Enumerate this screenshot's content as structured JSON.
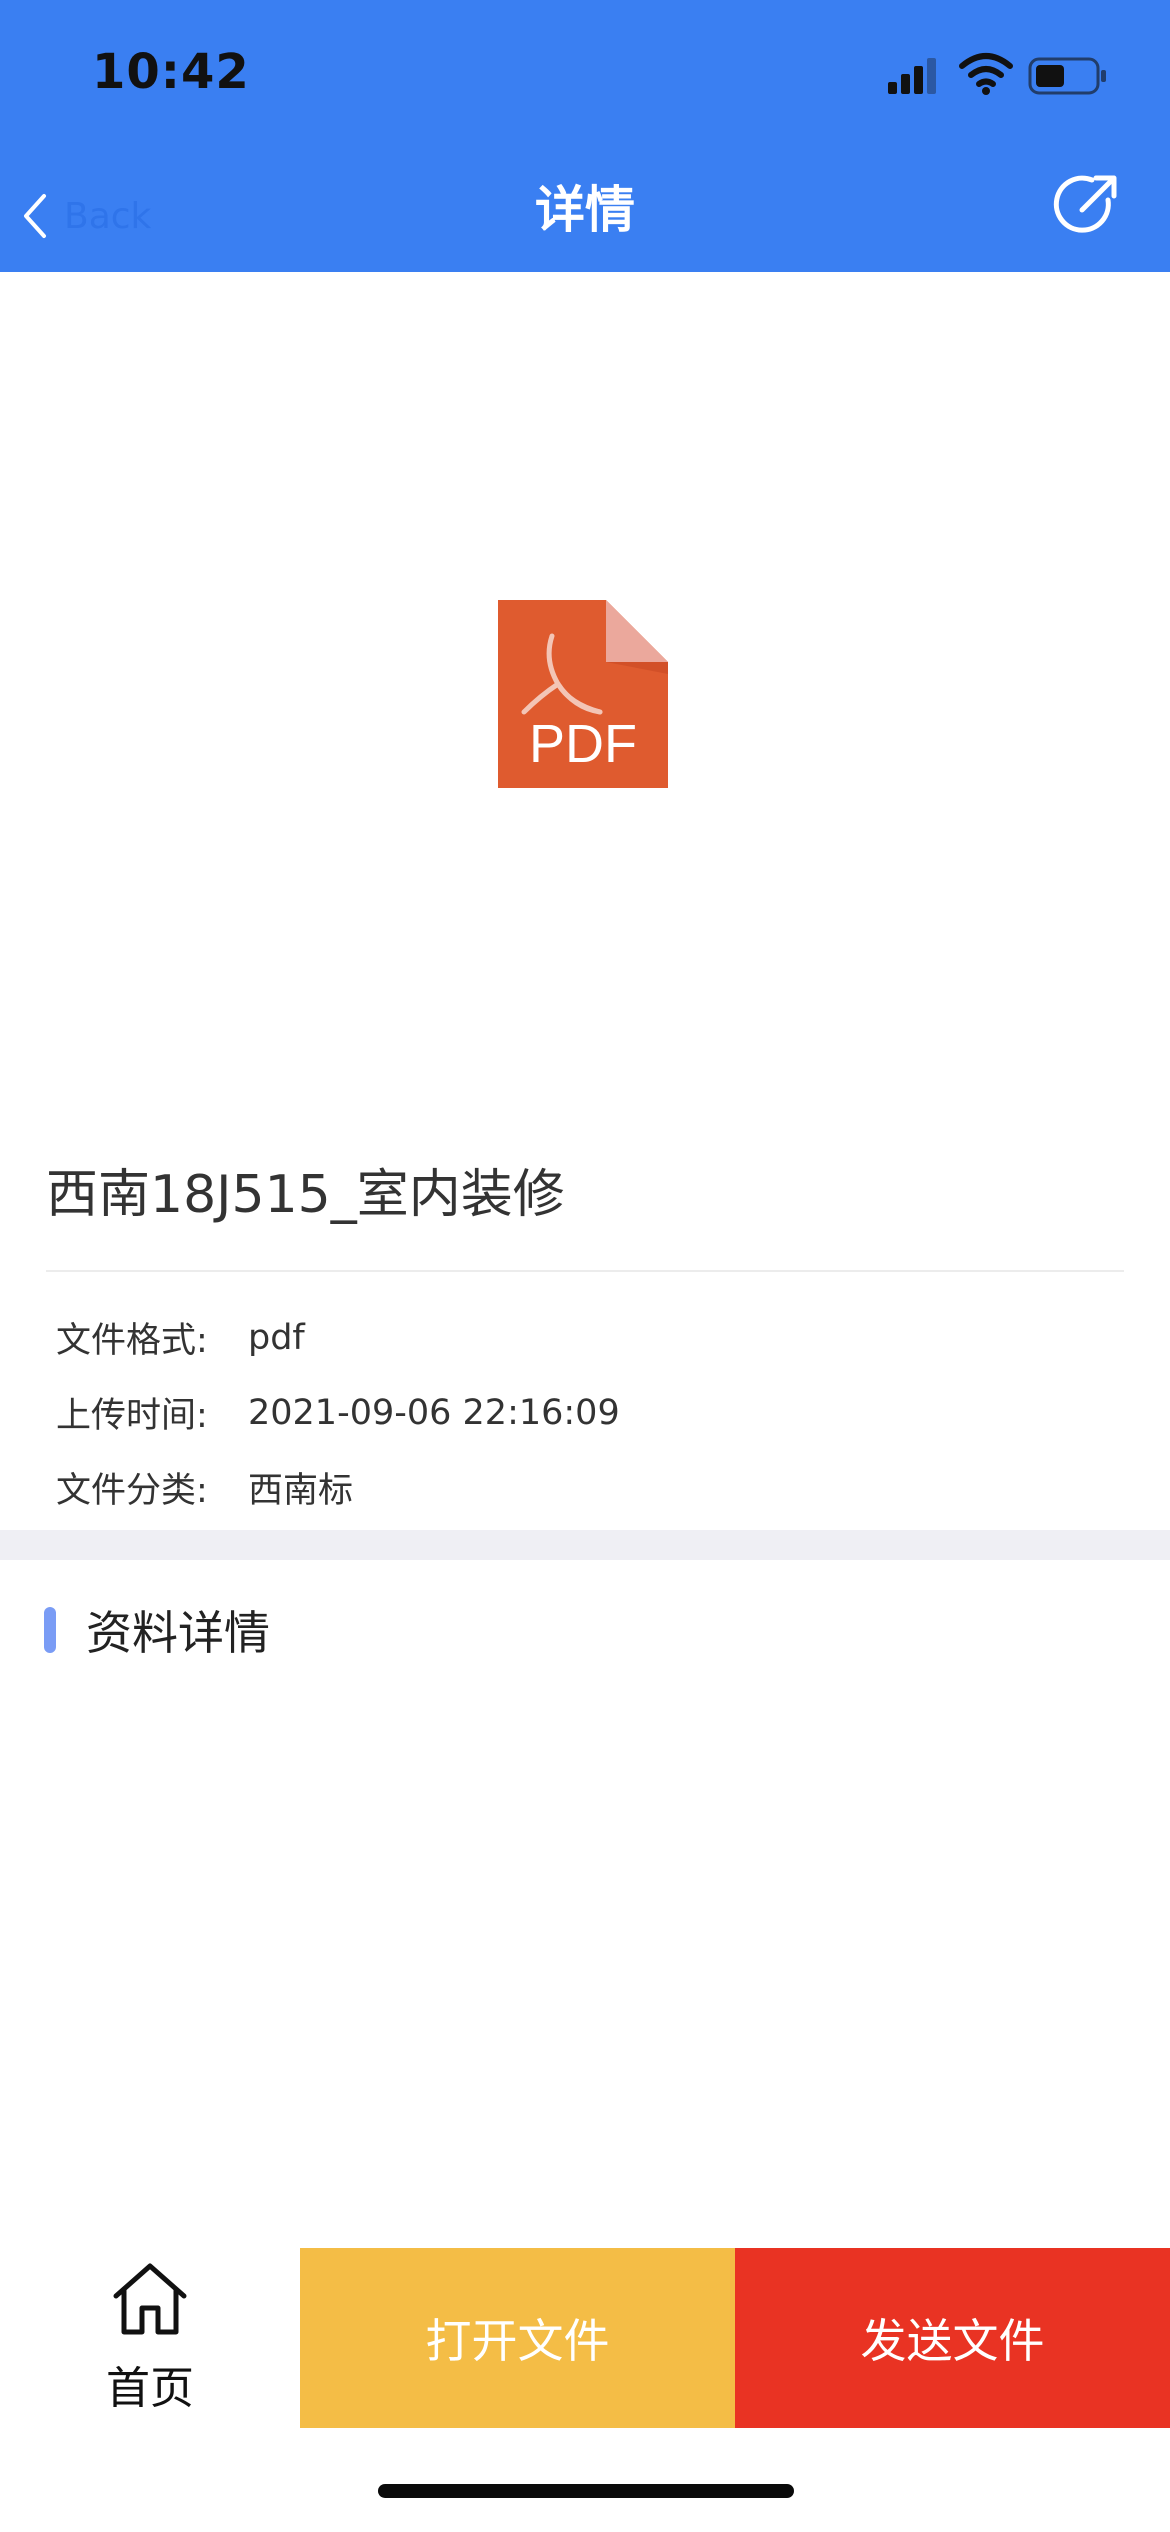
{
  "status_bar": {
    "time": "10:42"
  },
  "nav": {
    "back_label": "Back",
    "title": "详情"
  },
  "document": {
    "pdf_badge": "PDF",
    "title": "西南18J515_室内装修",
    "meta": [
      {
        "key": "文件格式:",
        "value": "pdf"
      },
      {
        "key": "上传时间:",
        "value": "2021-09-06 22:16:09"
      },
      {
        "key": "文件分类:",
        "value": "西南标"
      }
    ]
  },
  "section": {
    "title": "资料详情"
  },
  "bottom_bar": {
    "home_label": "首页",
    "open_label": "打开文件",
    "send_label": "发送文件"
  },
  "colors": {
    "header": "#3a7ff2",
    "open_button": "#f4bd46",
    "send_button": "#e93323",
    "pdf_icon": "#df5b2f",
    "section_accent": "#7a9cf5"
  }
}
